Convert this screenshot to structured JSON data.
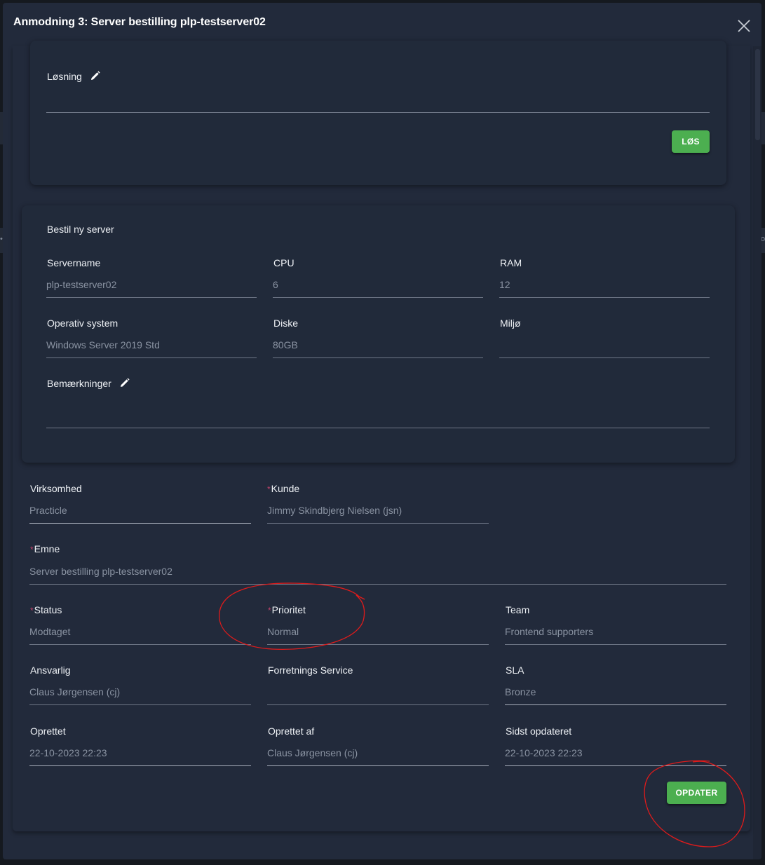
{
  "dialog": {
    "title": "Anmodning 3: Server bestilling plp-testserver02",
    "close_icon": "close-icon"
  },
  "solution": {
    "label": "Løsning",
    "value": "",
    "solve_button": "LØS"
  },
  "server_order": {
    "heading": "Bestil ny server",
    "fields": {
      "servername": {
        "label": "Servername",
        "value": "plp-testserver02"
      },
      "cpu": {
        "label": "CPU",
        "value": "6"
      },
      "ram": {
        "label": "RAM",
        "value": "12"
      },
      "os": {
        "label": "Operativ system",
        "value": "Windows Server 2019 Std"
      },
      "disks": {
        "label": "Diske",
        "value": "80GB"
      },
      "environment": {
        "label": "Miljø",
        "value": ""
      }
    },
    "remarks": {
      "label": "Bemærkninger",
      "value": ""
    }
  },
  "ticket": {
    "company": {
      "label": "Virksomhed",
      "value": "Practicle",
      "required": false
    },
    "customer": {
      "label": "Kunde",
      "value": "Jimmy Skindbjerg Nielsen (jsn)",
      "required": true
    },
    "subject": {
      "label": "Emne",
      "value": "Server bestilling plp-testserver02",
      "required": true
    },
    "status": {
      "label": "Status",
      "value": "Modtaget",
      "required": true
    },
    "priority": {
      "label": "Prioritet",
      "value": "Normal",
      "required": true
    },
    "team": {
      "label": "Team",
      "value": "Frontend supporters",
      "required": false
    },
    "responsible": {
      "label": "Ansvarlig",
      "value": "Claus Jørgensen (cj)",
      "required": false
    },
    "business_service": {
      "label": "Forretnings Service",
      "value": "",
      "required": false
    },
    "sla": {
      "label": "SLA",
      "value": "Bronze",
      "required": false
    },
    "created": {
      "label": "Oprettet",
      "value": "22-10-2023 22:23",
      "required": false
    },
    "created_by": {
      "label": "Oprettet af",
      "value": "Claus Jørgensen (cj)",
      "required": false
    },
    "last_updated": {
      "label": "Sidst opdateret",
      "value": "22-10-2023 22:23",
      "required": false
    },
    "required_marker": "*",
    "update_button": "OPDATER"
  },
  "colors": {
    "modal_bg": "#222a3b",
    "accent_green": "#4caf50",
    "required_marker": "#c0436b",
    "annotation_red": "#e01b1b"
  },
  "background_glyphs": {
    "left": "•",
    "right": "o"
  }
}
